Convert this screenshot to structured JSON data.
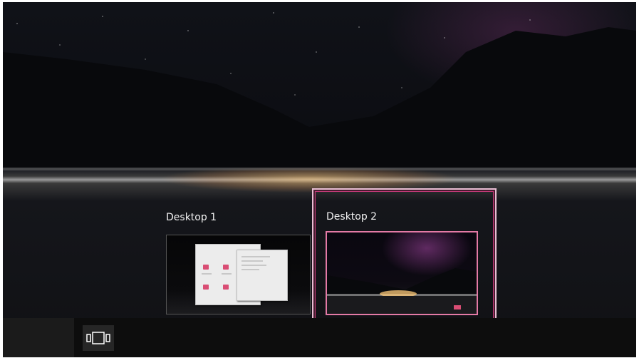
{
  "task_view": {
    "desktops": [
      {
        "label": "Desktop 1",
        "selected": false
      },
      {
        "label": "Desktop 2",
        "selected": true
      }
    ]
  },
  "taskbar": {
    "task_view_icon": "task-view-icon"
  },
  "colors": {
    "selection_border": "#e8bfd4",
    "selection_accent": "#c43a78",
    "taskbar": "#0d0d0d"
  }
}
